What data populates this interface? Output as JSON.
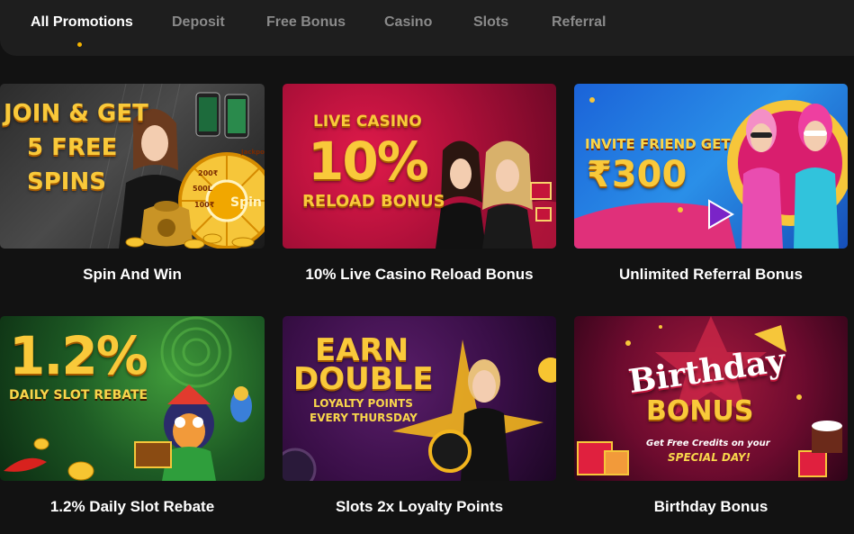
{
  "tabs": [
    {
      "label": "All Promotions",
      "active": true
    },
    {
      "label": "Deposit",
      "active": false
    },
    {
      "label": "Free Bonus",
      "active": false
    },
    {
      "label": "Casino",
      "active": false
    },
    {
      "label": "Slots",
      "active": false
    },
    {
      "label": "Referral",
      "active": false
    }
  ],
  "colors": {
    "accent": "#f5b400",
    "background": "#121212",
    "tabbar": "#1e1e1e"
  },
  "promotions": [
    {
      "title": "Spin And Win",
      "banner": {
        "line1": "JOIN & GET",
        "line2": "5 FREE",
        "line3": "SPINS",
        "wheel_labels": [
          "200₹",
          "500L",
          "100₹",
          "Jackpot",
          "Spin"
        ]
      }
    },
    {
      "title": "10% Live Casino Reload Bonus",
      "banner": {
        "line1": "LIVE CASINO",
        "line2": "10%",
        "line3": "RELOAD BONUS"
      }
    },
    {
      "title": "Unlimited Referral Bonus",
      "banner": {
        "line1": "INVITE FRIEND GET",
        "line2": "₹300"
      }
    },
    {
      "title": "1.2% Daily Slot Rebate",
      "banner": {
        "line1": "1.2%",
        "line2": "DAILY SLOT REBATE"
      }
    },
    {
      "title": "Slots 2x Loyalty Points",
      "banner": {
        "line1": "EARN",
        "line2": "DOUBLE",
        "line3": "LOYALTY POINTS",
        "line4": "EVERY THURSDAY"
      }
    },
    {
      "title": "Birthday Bonus",
      "banner": {
        "line1": "Birthday",
        "line2": "BONUS",
        "line3": "Get Free Credits on your",
        "line4": "SPECIAL DAY!"
      }
    }
  ]
}
